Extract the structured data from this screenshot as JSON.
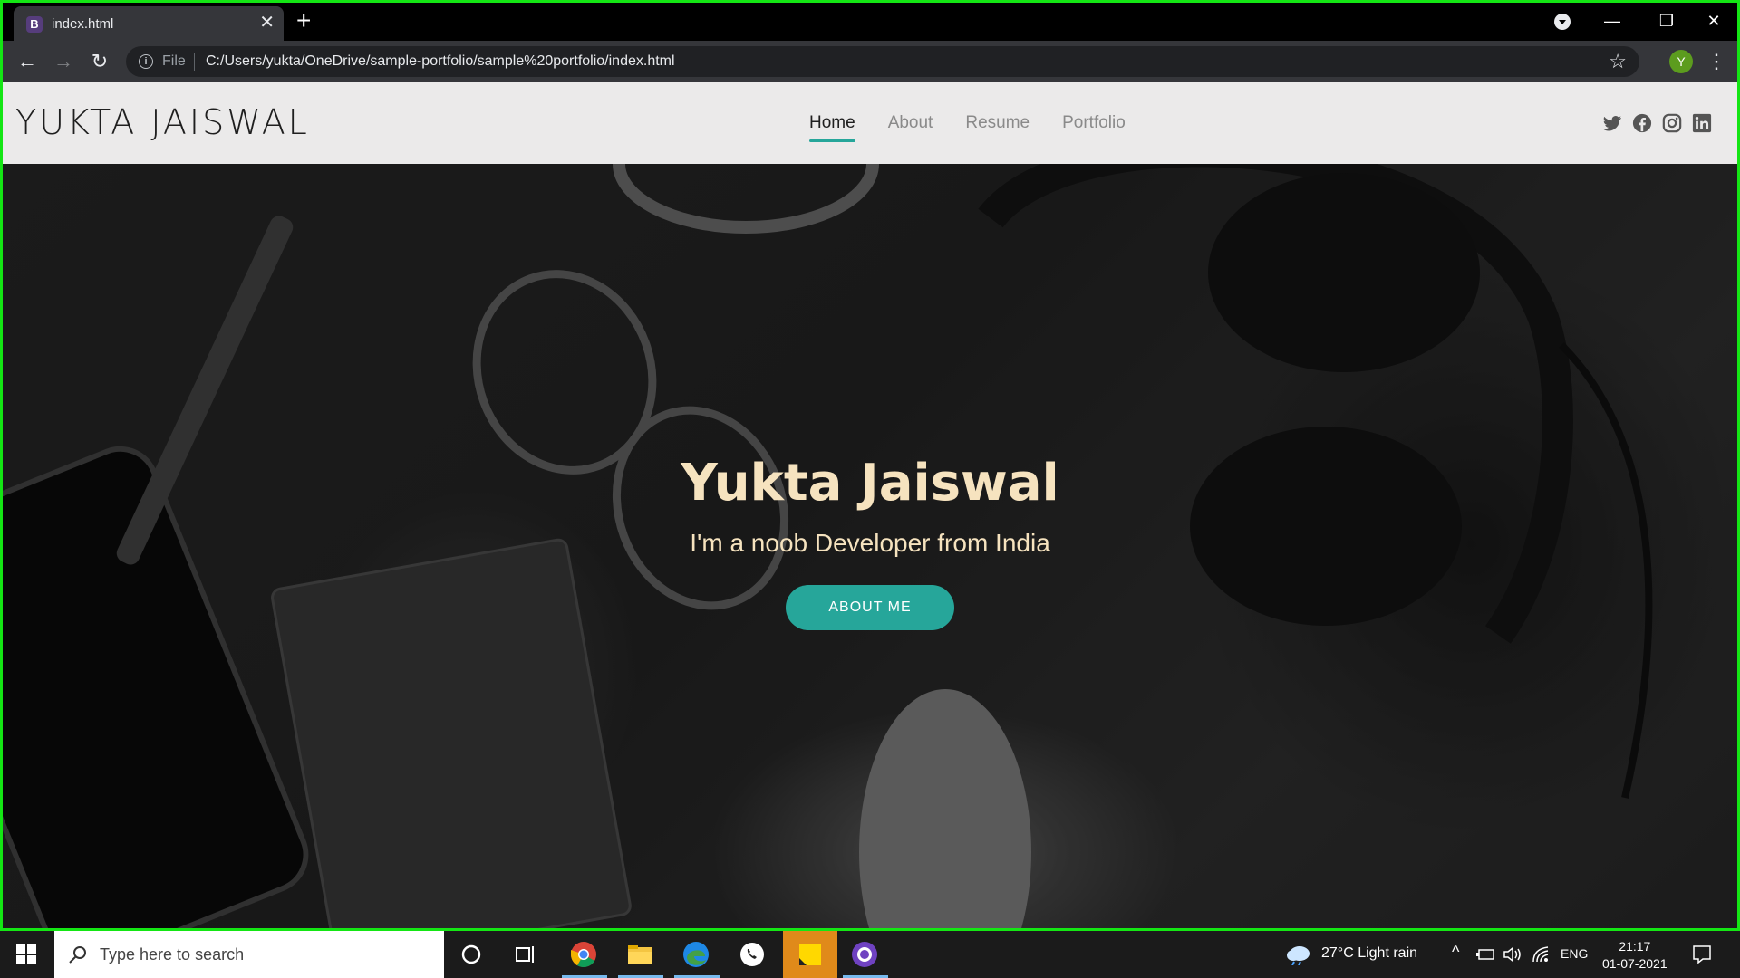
{
  "browser": {
    "tab_favicon_letter": "B",
    "tab_title": "index.html",
    "file_label": "File",
    "url": "C:/Users/yukta/OneDrive/sample-portfolio/sample%20portfolio/index.html",
    "profile_initial": "Y"
  },
  "site": {
    "logo": "YUKTA JAISWAL",
    "nav": [
      {
        "label": "Home",
        "active": true
      },
      {
        "label": "About",
        "active": false
      },
      {
        "label": "Resume",
        "active": false
      },
      {
        "label": "Portfolio",
        "active": false
      }
    ],
    "socials": [
      "twitter-icon",
      "facebook-icon",
      "instagram-icon",
      "linkedin-icon"
    ],
    "hero": {
      "title": "Yukta Jaiswal",
      "subtitle": "I'm a noob Developer from India",
      "button": "ABOUT ME"
    },
    "colors": {
      "accent": "#26a69a",
      "hero_text": "#f6e3bf",
      "header_bg": "#ebeaea"
    }
  },
  "taskbar": {
    "search_placeholder": "Type here to search",
    "weather": "27°C  Light rain",
    "language": "ENG",
    "time": "21:17",
    "date": "01-07-2021"
  }
}
